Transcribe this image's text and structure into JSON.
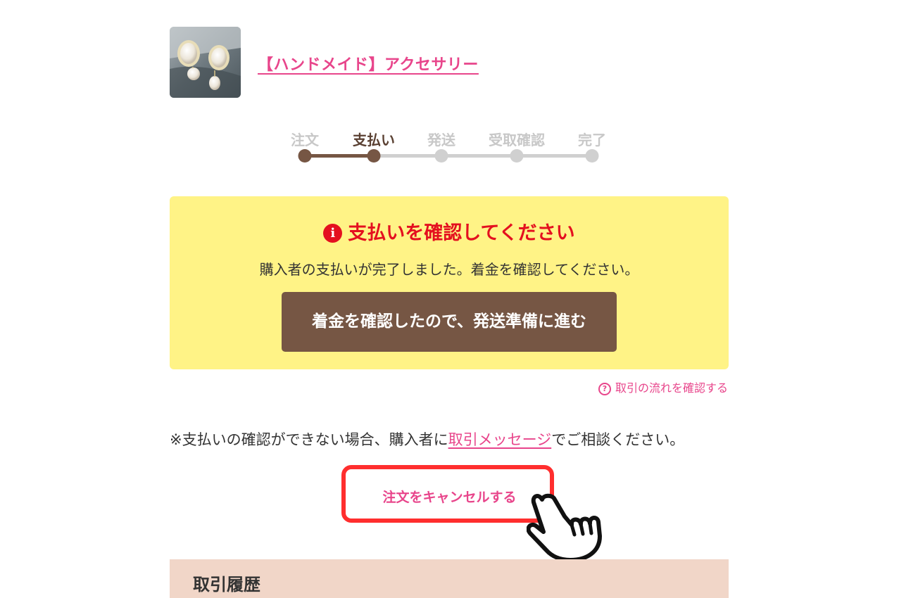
{
  "product": {
    "title": "【ハンドメイド】アクセサリー",
    "thumbnail": "pearl-earrings-photo"
  },
  "progress": {
    "steps": [
      {
        "label": "注文",
        "state": "done"
      },
      {
        "label": "支払い",
        "state": "current"
      },
      {
        "label": "発送",
        "state": "todo"
      },
      {
        "label": "受取確認",
        "state": "todo"
      },
      {
        "label": "完了",
        "state": "todo"
      }
    ],
    "colors": {
      "done": "#765644",
      "todo": "#d0d0d0"
    }
  },
  "notice": {
    "icon": "info-icon",
    "title": "支払いを確認してください",
    "text": "購入者の支払いが完了しました。着金を確認してください。",
    "button_label": "着金を確認したので、発送準備に進む",
    "background": "#fff386"
  },
  "flow_link": {
    "icon": "question-circle-icon",
    "label": "取引の流れを確認する"
  },
  "note": {
    "prefix": "※支払いの確認ができない場合、購入者に",
    "link": "取引メッセージ",
    "suffix": "でご相談ください。"
  },
  "cancel": {
    "label": "注文をキャンセルする",
    "highlight_color": "#ff2e2e"
  },
  "history": {
    "title": "取引履歴"
  },
  "accent_color": "#e8458b"
}
